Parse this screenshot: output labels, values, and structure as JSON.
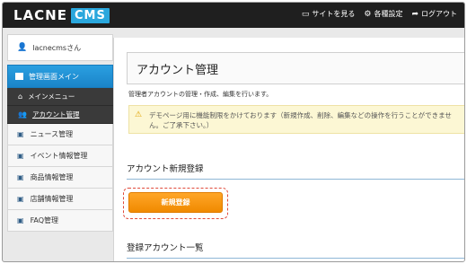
{
  "header": {
    "logo_main": "LACNE",
    "logo_box": "CMS",
    "links": [
      {
        "label": "サイトを見る",
        "icon": "monitor-icon",
        "glyph": "▭"
      },
      {
        "label": "各種設定",
        "icon": "gear-icon",
        "glyph": "⚙"
      },
      {
        "label": "ログアウト",
        "icon": "arrow-icon",
        "glyph": "➦"
      }
    ]
  },
  "sidebar": {
    "user": "lacnecmsさん",
    "active": "管理画面メイン",
    "sub_items": [
      "メインメニュー",
      "アカウント管理"
    ],
    "items": [
      "ニュース管理",
      "イベント情報管理",
      "商品情報管理",
      "店舗情報管理",
      "FAQ管理"
    ]
  },
  "main": {
    "title": "アカウント管理",
    "description": "管理者アカウントの管理・作成、編集を行います。",
    "notice": "デモページ用に機能制限をかけております（新規作成、削除、編集などの操作を行うことができません。ご了承下さい。）",
    "section_new": "アカウント新規登録",
    "new_button": "新規登録",
    "section_list": "登録アカウント一覧"
  },
  "colors": {
    "header_bg": "#1f1f1f",
    "brand_blue": "#2aa7dd",
    "accent_orange": "#f08a00",
    "notice_bg": "#fcf7d4"
  }
}
